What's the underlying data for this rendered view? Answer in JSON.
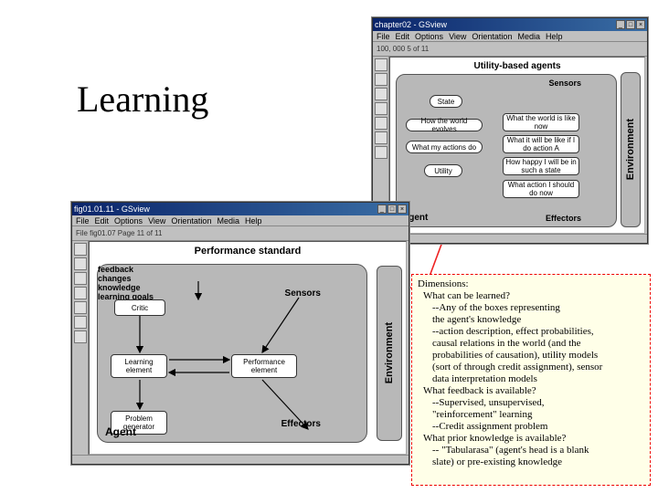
{
  "slide_title": "Learning",
  "windows": {
    "win1": {
      "title": "chapter02 - GSview",
      "menus": [
        "File",
        "Edit",
        "Options",
        "View",
        "Orientation",
        "Media",
        "Help"
      ],
      "toolbar_text": "100, 000   5 of 11",
      "diagram": {
        "title": "Utility-based agents",
        "sensors": "Sensors",
        "effectors": "Effectors",
        "agent": "Agent",
        "environment": "Environment",
        "boxes": {
          "state": "State",
          "evolve": "How the world evolves",
          "actions": "What my actions do",
          "utility": "Utility",
          "world_now": "What the world is like now",
          "do_a": "What it will be like if I do action A",
          "happy": "How happy I will be in such a state",
          "action": "What action I should do now"
        }
      }
    },
    "win2": {
      "title": "fig01.01.11 - GSview",
      "menus": [
        "File",
        "Edit",
        "Options",
        "View",
        "Orientation",
        "Media",
        "Help"
      ],
      "toolbar_text": "File fig01.07   Page 11 of 11",
      "diagram": {
        "performance_standard": "Performance standard",
        "sensors": "Sensors",
        "effectors": "Effectors",
        "agent": "Agent",
        "environment": "Environment",
        "boxes": {
          "critic": "Critic",
          "learning_element": "Learning element",
          "performance_element": "Performance element",
          "problem_generator": "Problem generator"
        },
        "labels": {
          "feedback": "feedback",
          "changes": "changes",
          "knowledge": "knowledge",
          "learning_goals": "learning goals"
        }
      }
    }
  },
  "dimensions": {
    "heading": "Dimensions:",
    "rows": [
      {
        "cls": "q",
        "t": "What can be learned?"
      },
      {
        "cls": "a",
        "t": "--Any of the boxes representing"
      },
      {
        "cls": "a",
        "t": "  the agent's knowledge"
      },
      {
        "cls": "a",
        "t": "--action description, effect probabilities,"
      },
      {
        "cls": "a",
        "t": "  causal relations in the world (and the"
      },
      {
        "cls": "a",
        "t": "  probabilities of causation), utility models"
      },
      {
        "cls": "a",
        "t": "  (sort of through credit assignment), sensor"
      },
      {
        "cls": "a",
        "t": " data interpretation models"
      },
      {
        "cls": "q",
        "t": "What feedback is available?"
      },
      {
        "cls": "a",
        "t": "  --Supervised, unsupervised,"
      },
      {
        "cls": "a",
        "t": "    \"reinforcement\" learning"
      },
      {
        "cls": "a",
        "t": "     --Credit assignment problem"
      },
      {
        "cls": "q",
        "t": "What prior knowledge is available?"
      },
      {
        "cls": "a",
        "t": " -- \"Tabularasa\" (agent's head is a blank"
      },
      {
        "cls": "a",
        "t": "   slate) or pre-existing knowledge"
      }
    ]
  }
}
